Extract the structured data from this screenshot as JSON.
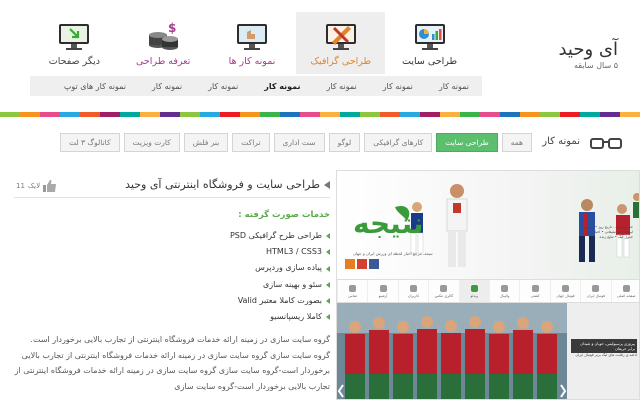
{
  "brand": {
    "title": "آی وحید",
    "subtitle": "۵ سال سابقه"
  },
  "nav": {
    "items": [
      {
        "label": "دیگر صفحات",
        "icon": "monitor-download-icon",
        "color": "#444444",
        "active": false
      },
      {
        "label": "تعرفه طراحی",
        "icon": "coins-icon",
        "color": "#a63c8f",
        "active": false
      },
      {
        "label": "نمونه کار ها",
        "icon": "monitor-hand-icon",
        "color": "#a63c8f",
        "active": false
      },
      {
        "label": "طراحی گرافیک",
        "icon": "pen-ruler-icon",
        "color": "#e0842c",
        "active": true
      },
      {
        "label": "طراحی سایت",
        "icon": "monitor-chart-icon",
        "color": "#2f8fd0",
        "active": false
      }
    ]
  },
  "subnav": {
    "items": [
      "نمونه کار",
      "نمونه کار",
      "نمونه کار",
      "نمونه کار",
      "نمونه کار",
      "نمونه کار",
      "نمونه کار های توپ"
    ],
    "active_index": 3
  },
  "stripe_colors": [
    "#8dc63f",
    "#f7941d",
    "#e84c8a",
    "#27aae1",
    "#f15a29",
    "#9e1f63",
    "#00a99d",
    "#fbb040",
    "#662d91",
    "#8dc63f",
    "#27aae1",
    "#ed1c24",
    "#f7941d",
    "#39b54a",
    "#1c75bc",
    "#e84c8a",
    "#fbb040",
    "#00a99d",
    "#8dc63f",
    "#f15a29",
    "#27aae1",
    "#9e1f63",
    "#fbb040",
    "#39b54a",
    "#e84c8a",
    "#1c75bc",
    "#f7941d",
    "#8dc63f",
    "#ed1c24",
    "#00a99d",
    "#662d91",
    "#fbb040"
  ],
  "portfolio": {
    "title": "نمونه کار",
    "filters": [
      "همه",
      "طراحی سایت",
      "کارهای گرافیکی",
      "لوگو",
      "ست اداری",
      "تراکت",
      "بنر فلش",
      "کارت ویزیت",
      "کاتالوگ ۳ لت"
    ],
    "active_filter": 1
  },
  "project": {
    "title": "طراحی سایت و فروشگاه اینترنتی آی وحید",
    "likes": "11",
    "likes_label": "لایک",
    "services_title": "خدمات صورت گرفته :",
    "services": [
      "طراحی طرح گرافیکی PSD",
      "HTML3 / CSS3",
      "پیاده سازی وردپرس",
      "سئو و بهینه سازی",
      "بصورت کاملا معتبر Valid",
      "کاملا ریسپانسیو"
    ],
    "description": "گروه سایت سازی در زمینه ارائه خدمات فروشگاه اینترنتی از تجارب بالایی برخوردار است. گروه سایت سازی گروه سایت سازی در زمینه ارائه خدمات فروشگاه اینترنتی از تجارب بالایی برخوردار است-گروه سایت سازی گروه سایت سازی در زمینه ارائه خدمات فروشگاه اینترنتی از تجارب بالایی برخوردار است-گروه سایت سازی"
  },
  "preview": {
    "logo_text": "نتیجه",
    "tagline": "نتیجه، مرجع اخبار لحظه ای ورزش ایران و جهان",
    "side_text": "خبر ورزشی - تاریخ روز • ورزش ایران • بنر تبلیغاتی • اخبار • جدول لیگ • نتایج زنده",
    "nav_items": [
      "صفحه اصلی",
      "فوتبال ایران",
      "فوتبال جهان",
      "کشتی",
      "والیبال",
      "ویدئو",
      "گالری عکس",
      "کاربران",
      "آرشیو",
      "تماس"
    ],
    "active_nav": 5,
    "side_head": "پیروزی پرسپولیس، خوبان و شیدان برابر حریفان",
    "side_sub": "ادامه ی رقابت های لیگ برتر فوتبال ایران"
  }
}
